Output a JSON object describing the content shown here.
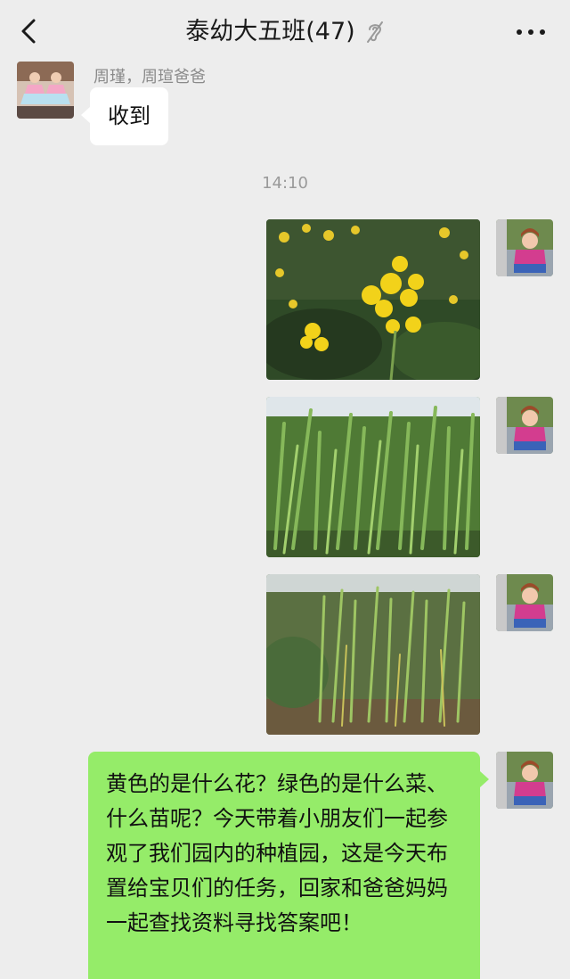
{
  "header": {
    "title": "泰幼大五班(47)",
    "back_icon": "chevron-left-icon",
    "mute_icon": "ear-mute-icon",
    "more_icon": "ellipsis-icon"
  },
  "messages": {
    "incoming": {
      "sender": "周瑾，周瑄爸爸",
      "text": "收到"
    },
    "timestamp": "14:10",
    "outgoing_text": "黄色的是什么花？绿色的是什么菜、什么苗呢？今天带着小朋友们一起参观了我们园内的种植园，这是今天布置给宝贝们的任务，回家和爸爸妈妈一起查找资料寻找答案吧！"
  },
  "colors": {
    "background": "#ededed",
    "bubble_in": "#ffffff",
    "bubble_out": "#95ec69"
  }
}
